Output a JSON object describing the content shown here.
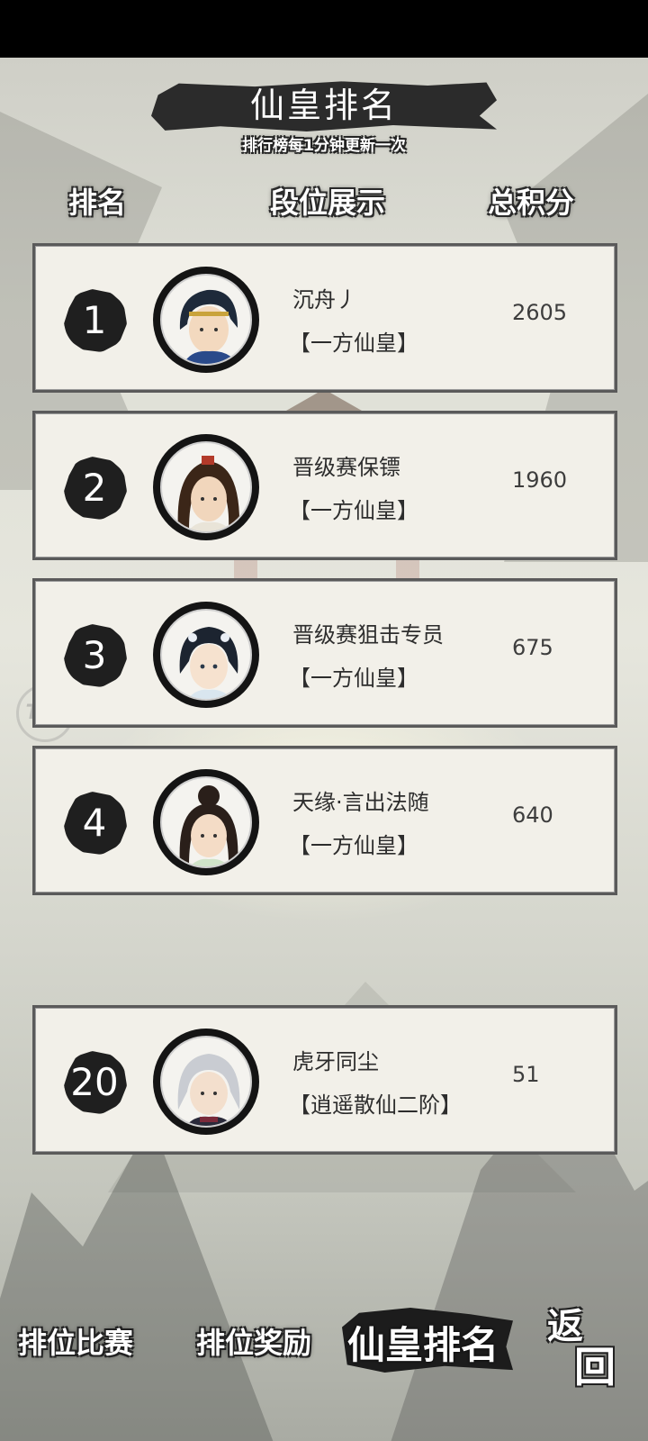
{
  "header": {
    "title": "仙皇排名",
    "subtitle": "排行榜每1分钟更新一次"
  },
  "columns": {
    "rank": "排名",
    "tier": "段位展示",
    "score": "总积分"
  },
  "rows": [
    {
      "rank": "1",
      "name": "沉舟丿",
      "tier": "【一方仙皇】",
      "score": "2605",
      "avatar": "male-warrior-avatar-icon"
    },
    {
      "rank": "2",
      "name": "晋级赛保镖",
      "tier": "【一方仙皇】",
      "score": "1960",
      "avatar": "male-longhair-avatar-icon"
    },
    {
      "rank": "3",
      "name": "晋级赛狙击专员",
      "tier": "【一方仙皇】",
      "score": "675",
      "avatar": "female-hairpin-avatar-icon"
    },
    {
      "rank": "4",
      "name": "天缘·言出法随",
      "tier": "【一方仙皇】",
      "score": "640",
      "avatar": "female-bun-avatar-icon"
    },
    {
      "rank": "20",
      "name": "虎牙同尘",
      "tier": "【逍遥散仙二阶】",
      "score": "51",
      "avatar": "silver-hair-avatar-icon"
    }
  ],
  "nav": {
    "match": "排位比赛",
    "reward": "排位奖励",
    "ranking": "仙皇排名",
    "back_top": "返",
    "back_bottom": "回"
  },
  "watermark": "Tap",
  "colors": {
    "card_bg": "#f2f0e9",
    "ink": "#1f1f1f",
    "text": "#2d2d2d"
  }
}
